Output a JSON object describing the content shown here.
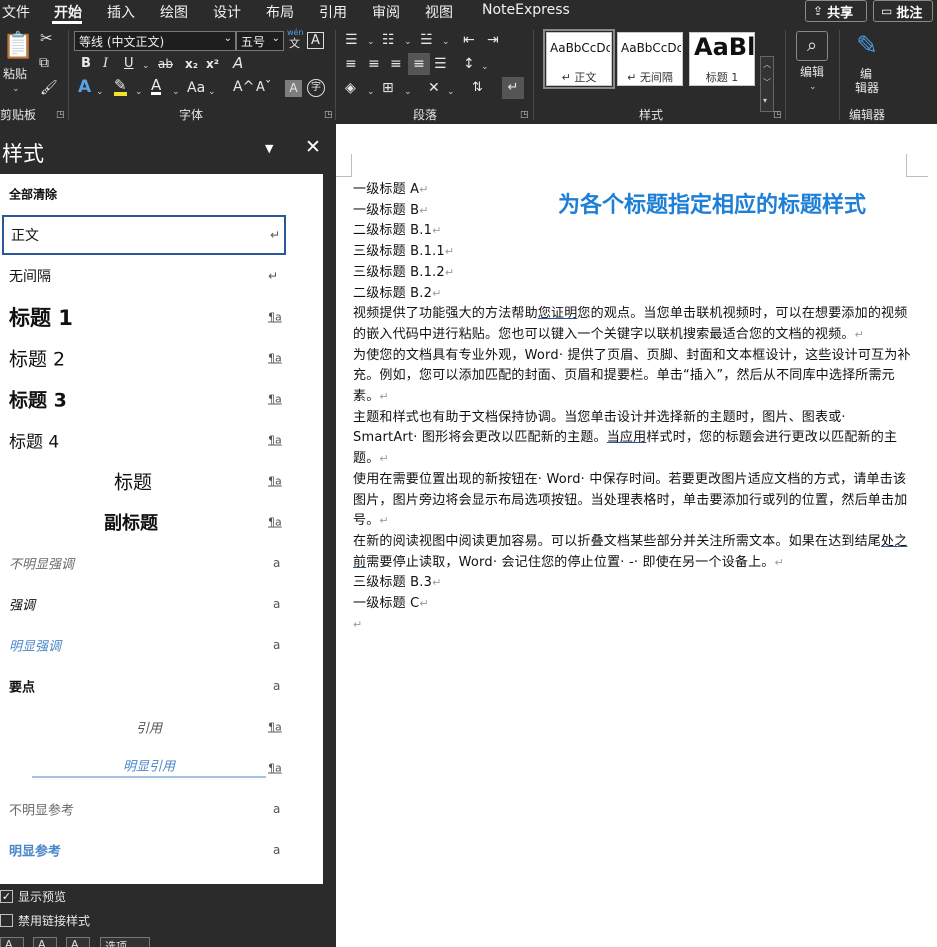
{
  "menubar": {
    "items": [
      "文件",
      "开始",
      "插入",
      "绘图",
      "设计",
      "布局",
      "引用",
      "审阅",
      "视图",
      "NoteExpress"
    ],
    "active_index": 1,
    "share_label": "共享",
    "comment_label": "批注"
  },
  "ribbon": {
    "clipboard": {
      "paste_label": "粘贴",
      "group_label": "剪贴板"
    },
    "font": {
      "font_name": "等线 (中文正文)",
      "font_size": "五号",
      "phonetic_top": "wén",
      "phonetic_bottom": "文",
      "border_char": "A",
      "bold": "B",
      "italic": "I",
      "underline": "U",
      "strike": "ab",
      "subscript": "x₂",
      "superscript": "x²",
      "clear_format": "A",
      "text_effect": "A",
      "highlight": "✎",
      "font_color": "A",
      "case": "Aa",
      "grow": "A^",
      "shrink": "Aˇ",
      "char_shading": "A",
      "enclose": "字",
      "group_label": "字体"
    },
    "paragraph": {
      "group_label": "段落"
    },
    "styles": {
      "cards": [
        {
          "sample": "AaBbCcDc",
          "name": "↵ 正文"
        },
        {
          "sample": "AaBbCcDc",
          "name": "↵ 无间隔"
        },
        {
          "sample": "AaBl",
          "name": "标题 1"
        }
      ],
      "group_label": "样式"
    },
    "editing": {
      "label": "编辑",
      "group_label": ""
    },
    "editor": {
      "label_line1": "编",
      "label_line2": "辑器",
      "group_label": "编辑器"
    }
  },
  "styles_pane": {
    "title": "样式",
    "items": [
      {
        "label": "全部清除",
        "mark": ""
      },
      {
        "label": "正文",
        "mark": "↵"
      },
      {
        "label": "无间隔",
        "mark": "↵"
      },
      {
        "label": "标题 1",
        "mark": "¶a"
      },
      {
        "label": "标题 2",
        "mark": "¶a"
      },
      {
        "label": "标题 3",
        "mark": "¶a"
      },
      {
        "label": "标题 4",
        "mark": "¶a"
      },
      {
        "label": "标题",
        "mark": "¶a"
      },
      {
        "label": "副标题",
        "mark": "¶a"
      },
      {
        "label": "不明显强调",
        "mark": "a"
      },
      {
        "label": "强调",
        "mark": "a"
      },
      {
        "label": "明显强调",
        "mark": "a"
      },
      {
        "label": "要点",
        "mark": "a"
      },
      {
        "label": "引用",
        "mark": "¶a"
      },
      {
        "label": "明显引用",
        "mark": "¶a"
      },
      {
        "label": "不明显参考",
        "mark": "a"
      },
      {
        "label": "明显参考",
        "mark": "a"
      }
    ],
    "show_preview_label": "显示预览",
    "disable_linked_label": "禁用链接样式",
    "options_label": "选项..."
  },
  "document": {
    "heading_note": "为各个标题指定相应的标题样式",
    "lines": [
      "一级标题 A",
      "一级标题 B",
      "二级标题 B.1",
      "三级标题 B.1.1",
      "三级标题 B.1.2",
      "二级标题 B.2"
    ],
    "p1_a": "视频提供了功能强大的方法帮助",
    "p1_link": "您证明",
    "p1_b": "您的观点。当您单击联机视频时，可以在想要添加的视频的嵌入代码中进行粘贴。您也可以键入一个关键字以联机搜索最适合您的文档的视频。",
    "p2": "为使您的文档具有专业外观，Word· 提供了页眉、页脚、封面和文本框设计，这些设计可互为补充。例如，您可以添加匹配的封面、页眉和提要栏。单击“插入”，然后从不同库中选择所需元素。",
    "p3_a": "主题和样式也有助于文档保持协调。当您单击设计并选择新的主题时，图片、图表或· SmartArt· 图形将会更改以匹配新的主题。",
    "p3_link": "当应用",
    "p3_b": "样式时，您的标题会进行更改以匹配新的主题。",
    "p4": "使用在需要位置出现的新按钮在· Word· 中保存时间。若要更改图片适应文档的方式，请单击该图片，图片旁边将会显示布局选项按钮。当处理表格时，单击要添加行或列的位置，然后单击加号。",
    "p5_a": "在新的阅读视图中阅读更加容易。可以折叠文档某些部分并关注所需文本。如果在达到结尾",
    "p5_link": "处之前",
    "p5_b": "需要停止读取，Word· 会记住您的停止位置· -· 即使在另一个设备上。",
    "tail_lines": [
      "三级标题 B.3",
      "一级标题 C"
    ],
    "para_mark": "↵"
  }
}
